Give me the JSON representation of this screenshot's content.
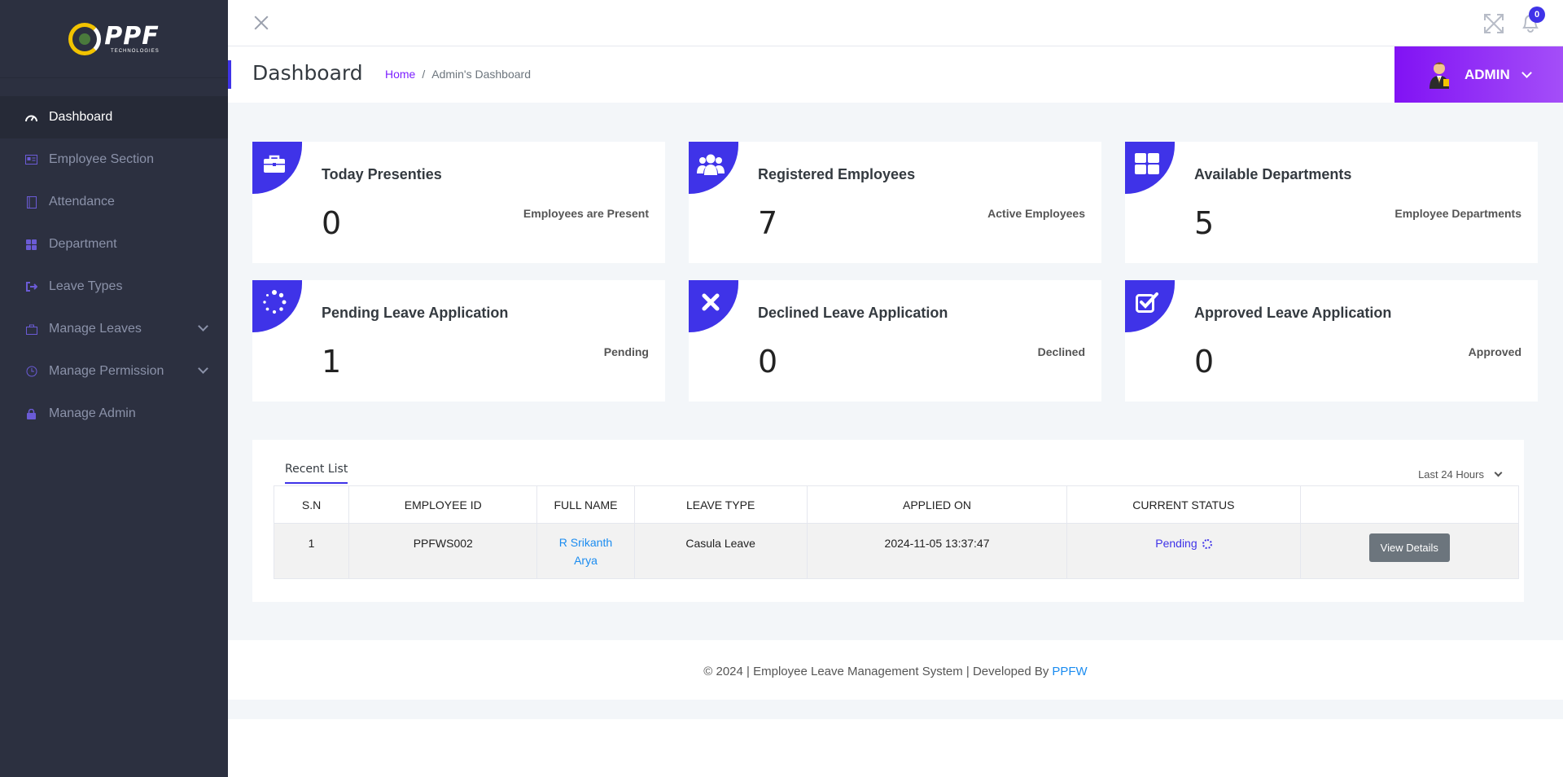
{
  "sidebar": {
    "logo_text": "PPF",
    "logo_subtext": "TECHNOLOGIES",
    "items": [
      {
        "label": "Dashboard",
        "icon": "dashboard-icon",
        "active": true
      },
      {
        "label": "Employee Section",
        "icon": "id-card-icon"
      },
      {
        "label": "Attendance",
        "icon": "notebook-icon"
      },
      {
        "label": "Department",
        "icon": "grid-icon"
      },
      {
        "label": "Leave Types",
        "icon": "exit-icon"
      },
      {
        "label": "Manage Leaves",
        "icon": "briefcase-icon",
        "has_submenu": true
      },
      {
        "label": "Manage Permission",
        "icon": "clock-icon",
        "has_submenu": true
      },
      {
        "label": "Manage Admin",
        "icon": "lock-icon"
      }
    ]
  },
  "topbar": {
    "notification_count": "0"
  },
  "header": {
    "title": "Dashboard",
    "breadcrumb_home": "Home",
    "breadcrumb_separator": "/",
    "breadcrumb_current": "Admin's Dashboard",
    "user_label": "ADMIN"
  },
  "cards": [
    {
      "title": "Today Presenties",
      "value": "0",
      "subtitle": "Employees are Present",
      "icon": "briefcase-icon"
    },
    {
      "title": "Registered Employees",
      "value": "7",
      "subtitle": "Active Employees",
      "icon": "users-icon"
    },
    {
      "title": "Available Departments",
      "value": "5",
      "subtitle": "Employee Departments",
      "icon": "grid-icon"
    },
    {
      "title": "Pending Leave Application",
      "value": "1",
      "subtitle": "Pending",
      "icon": "spinner-icon"
    },
    {
      "title": "Declined Leave Application",
      "value": "0",
      "subtitle": "Declined",
      "icon": "x-icon"
    },
    {
      "title": "Approved Leave Application",
      "value": "0",
      "subtitle": "Approved",
      "icon": "check-square-icon"
    }
  ],
  "recent_list": {
    "tab_label": "Recent List",
    "filter_label": "Last 24 Hours",
    "columns": [
      "S.N",
      "EMPLOYEE ID",
      "FULL NAME",
      "LEAVE TYPE",
      "APPLIED ON",
      "CURRENT STATUS",
      ""
    ],
    "rows": [
      {
        "sn": "1",
        "employee_id": "PPFWS002",
        "full_name": "R Srikanth Arya",
        "leave_type": "Casula Leave",
        "applied_on": "2024-11-05 13:37:47",
        "status": "Pending",
        "action_label": "View Details"
      }
    ]
  },
  "footer": {
    "text": "© 2024 | Employee Leave Management System | Developed By",
    "link": "PPFW"
  },
  "colors": {
    "sidebar_bg": "#2c3040",
    "accent": "#3f33e8",
    "admin_gradient_start": "#8112f4",
    "admin_gradient_end": "#a44ef8",
    "link": "#1b8cf0"
  }
}
